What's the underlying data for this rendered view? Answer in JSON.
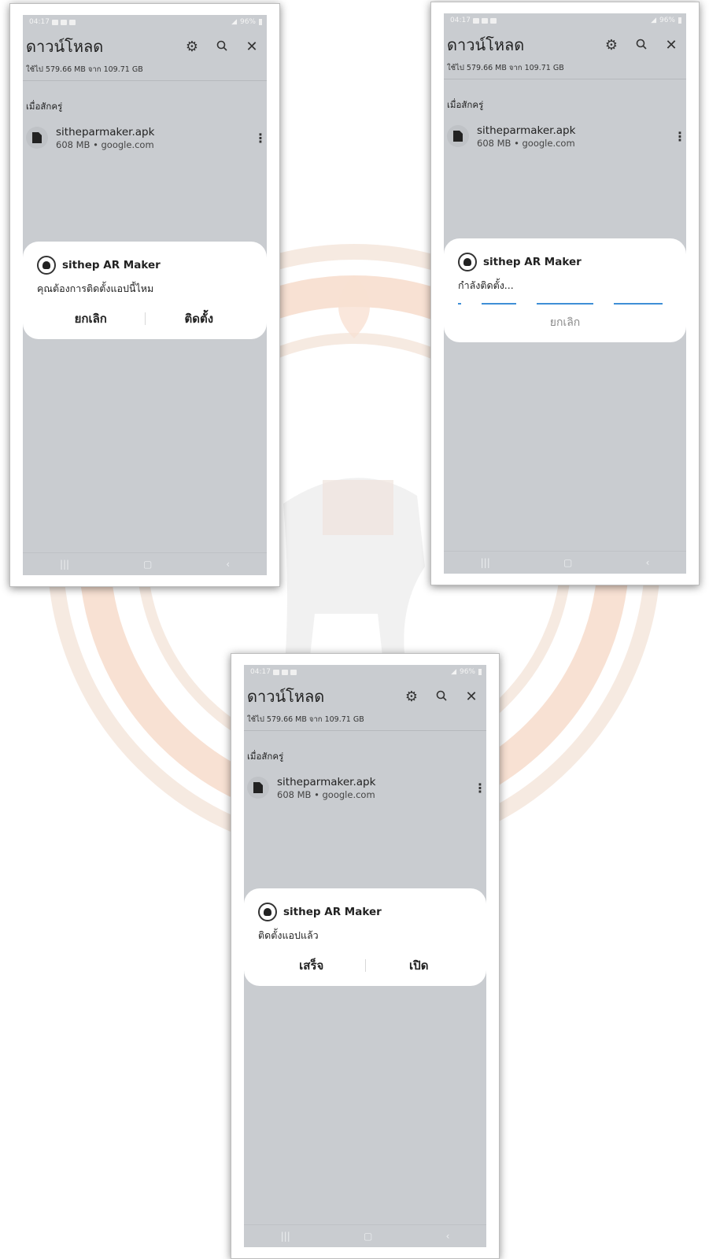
{
  "screens": [
    {
      "status_time": "04:17",
      "status_battery": "96%",
      "title": "ดาวน์โหลด",
      "usage": "ใช้ไป 579.66 MB จาก 109.71 GB",
      "section": "เมื่อสักครู่",
      "file": {
        "name": "sitheparmaker.apk",
        "meta": "608 MB • google.com"
      },
      "dialog": {
        "app_name": "sithep AR Maker",
        "message": "คุณต้องการติดตั้งแอปนี้ไหม",
        "buttons": [
          "ยกเลิก",
          "ติดตั้ง"
        ]
      }
    },
    {
      "status_time": "04:17",
      "status_battery": "96%",
      "title": "ดาวน์โหลด",
      "usage": "ใช้ไป 579.66 MB จาก 109.71 GB",
      "section": "เมื่อสักครู่",
      "file": {
        "name": "sitheparmaker.apk",
        "meta": "608 MB • google.com"
      },
      "dialog": {
        "app_name": "sithep AR Maker",
        "message": "กำลังติดตั้ง...",
        "cancel": "ยกเลิก"
      }
    },
    {
      "status_time": "04:17",
      "status_battery": "96%",
      "title": "ดาวน์โหลด",
      "usage": "ใช้ไป 579.66 MB จาก 109.71 GB",
      "section": "เมื่อสักครู่",
      "file": {
        "name": "sitheparmaker.apk",
        "meta": "608 MB • google.com"
      },
      "dialog": {
        "app_name": "sithep AR Maker",
        "message": "ติดตั้งแอปแล้ว",
        "buttons": [
          "เสร็จ",
          "เปิด"
        ]
      }
    }
  ],
  "icons": {
    "settings": "gear-icon",
    "search": "search-icon",
    "close": "close-icon",
    "file": "file-icon",
    "more": "more-vert-icon",
    "nav_recent": "recent-apps-icon",
    "nav_home": "home-icon",
    "nav_back": "back-icon"
  },
  "colors": {
    "screen_bg": "#c9ccd0",
    "dialog_bg": "#ffffff",
    "progress": "#3f8fd6",
    "watermark": "#e8a27a"
  }
}
